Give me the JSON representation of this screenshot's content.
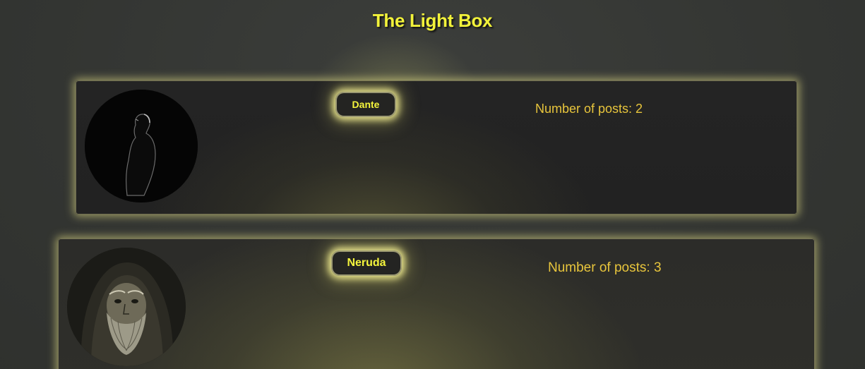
{
  "page": {
    "title": "The Light Box"
  },
  "colors": {
    "accent_yellow": "#f2f23a",
    "post_count_text": "#e8c53c",
    "card_background": "#232323",
    "page_background": "#353735",
    "glow": "#f0eb8c"
  },
  "users": [
    {
      "name": "Dante",
      "post_count_label": "Number of posts: 2",
      "avatar_icon": "silhouette-portrait-icon"
    },
    {
      "name": "Neruda",
      "post_count_label": "Number of posts: 3",
      "avatar_icon": "bearded-man-portrait-icon"
    }
  ]
}
